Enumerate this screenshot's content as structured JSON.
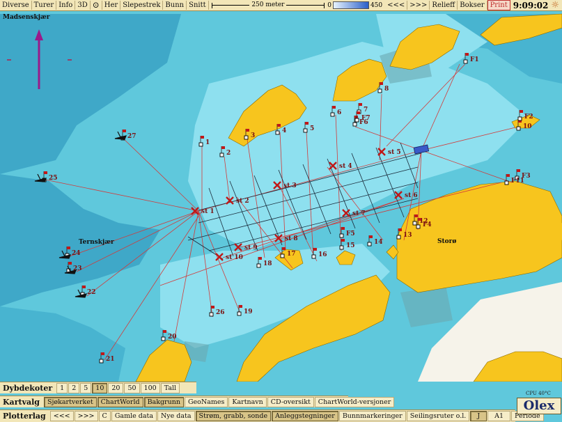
{
  "toolbar": {
    "items": [
      "Diverse",
      "Turer",
      "Info",
      "3D",
      "Her",
      "Slepestrek",
      "Bunn",
      "Snitt"
    ],
    "scale_label": "250 meter",
    "depth_min": "0",
    "depth_max": "450",
    "nav": [
      "<<<",
      ">>>"
    ],
    "right": [
      "Relieff",
      "Bokser",
      "Print"
    ],
    "time": "9:09:02"
  },
  "places": {
    "top_left": "Madsenskjær",
    "mid_left": "Ternskjær",
    "right": "Storø"
  },
  "markers": {
    "stations": [
      "st 1",
      "st 2",
      "st 3",
      "st 4",
      "st 5",
      "st 6",
      "st 7",
      "st 8",
      "st 9",
      "st 10"
    ],
    "flags": [
      "1",
      "2",
      "3",
      "4",
      "5",
      "6",
      "7",
      "8",
      "10",
      "12",
      "13",
      "14",
      "15",
      "16",
      "17",
      "18",
      "19",
      "20",
      "21",
      "22",
      "23",
      "24",
      "25",
      "26",
      "27",
      "F1",
      "F2",
      "F3",
      "F4",
      "F5",
      "F6",
      "F7",
      "F11"
    ]
  },
  "dybdekoter": {
    "title": "Dybdekoter",
    "options": [
      "1",
      "2",
      "5",
      "10",
      "20",
      "50",
      "100",
      "Tall"
    ],
    "selected": "10"
  },
  "kartvalg": {
    "title": "Kartvalg",
    "options": [
      "Sjøkartverket",
      "ChartWorld",
      "Bakgrunn",
      "GeoNames",
      "Kartnavn",
      "CD-oversikt",
      "ChartWorld-versjoner"
    ],
    "selected": [
      "Sjøkartverket",
      "ChartWorld",
      "Bakgrunn"
    ]
  },
  "plotterlag": {
    "title": "Plotterlag",
    "options": [
      "<<<",
      ">>>",
      "C",
      "Gamle data",
      "Nye data",
      "Strøm, grabb, sonde",
      "Anleggstegninger",
      "Bunnmarkeringer",
      "Seilingsruter o.l.",
      "J",
      "A1",
      "Periode"
    ],
    "selected": [
      "Strøm, grabb, sonde",
      "Anleggstegninger",
      "J"
    ]
  },
  "status": {
    "cpu": "CPU 40°C",
    "brand": "Olex"
  },
  "colors": {
    "land": "#f7c51e",
    "shallow": "#8ee0ef",
    "mid": "#5fc8dc",
    "deep": "#3fa8c8",
    "route": "#d23a3a",
    "grid": "#1a2a3a"
  },
  "icons": [
    "compass-icon",
    "sun-icon",
    "north-arrow-icon",
    "station-x-icon",
    "flag-icon",
    "trawler-icon"
  ]
}
